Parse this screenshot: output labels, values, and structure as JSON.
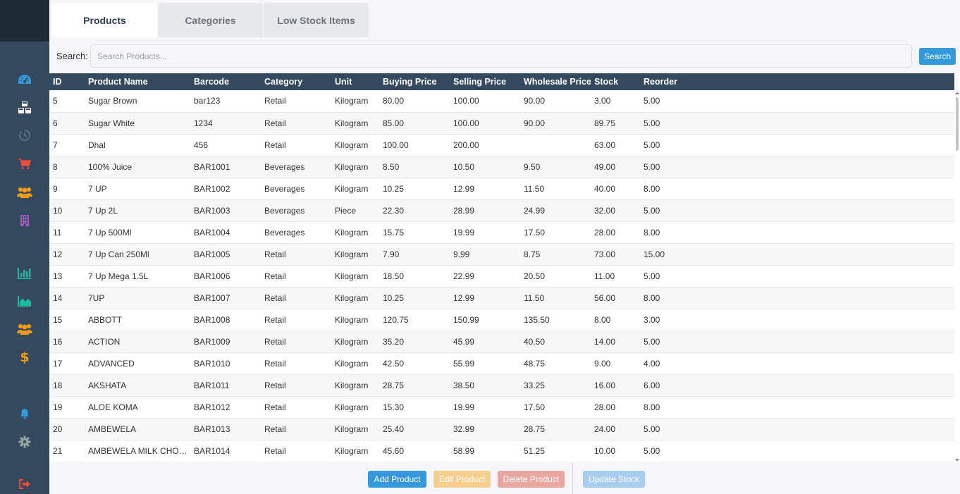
{
  "colors": {
    "sidebar_bg": "#34495e",
    "header_bg": "#34495e",
    "primary": "#3498db",
    "warning_disabled": "#f6cf8f",
    "danger_disabled": "#eaa7a1",
    "info_disabled": "#a9cdee"
  },
  "sidebar": {
    "icons": [
      {
        "name": "dashboard-icon",
        "color": "#3498db"
      },
      {
        "name": "products-cubes-icon",
        "color": "#ffffff"
      },
      {
        "name": "history-icon",
        "color": "#5d6d7e"
      },
      {
        "name": "cart-icon",
        "color": "#e74c3c"
      },
      {
        "name": "users-icon",
        "color": "#f39c12"
      },
      {
        "name": "building-icon",
        "color": "#9b59b6"
      },
      {
        "name": "bar-chart-icon",
        "color": "#1abc9c"
      },
      {
        "name": "area-chart-icon",
        "color": "#1abc9c"
      },
      {
        "name": "customers-icon",
        "color": "#f39c12"
      },
      {
        "name": "dollar-icon",
        "color": "#f39c12"
      },
      {
        "name": "bell-icon",
        "color": "#3498db"
      },
      {
        "name": "gear-icon",
        "color": "#95a5a6"
      },
      {
        "name": "logout-icon",
        "color": "#e74c3c"
      }
    ]
  },
  "tabs": [
    {
      "label": "Products"
    },
    {
      "label": "Categories"
    },
    {
      "label": "Low Stock Items"
    }
  ],
  "search": {
    "label": "Search:",
    "placeholder": "Search Products...",
    "button": "Search"
  },
  "table": {
    "columns": [
      "ID",
      "Product Name",
      "Barcode",
      "Category",
      "Unit",
      "Buying Price",
      "Selling Price",
      "Wholesale Price",
      "Stock",
      "Reorder"
    ],
    "rows": [
      [
        "5",
        "Sugar Brown",
        "bar123",
        "Retail",
        "Kilogram",
        "80.00",
        "100.00",
        "90.00",
        "3.00",
        "5.00"
      ],
      [
        "6",
        "Sugar White",
        "1234",
        "Retail",
        "Kilogram",
        "85.00",
        "100.00",
        "90.00",
        "89.75",
        "5.00"
      ],
      [
        "7",
        "Dhal",
        "456",
        "Retail",
        "Kilogram",
        "100.00",
        "200.00",
        "",
        "63.00",
        "5.00"
      ],
      [
        "8",
        "100% Juice",
        "BAR1001",
        "Beverages",
        "Kilogram",
        "8.50",
        "10.50",
        "9.50",
        "49.00",
        "5.00"
      ],
      [
        "9",
        "7 UP",
        "BAR1002",
        "Beverages",
        "Kilogram",
        "10.25",
        "12.99",
        "11.50",
        "40.00",
        "8.00"
      ],
      [
        "10",
        "7 Up 2L",
        "BAR1003",
        "Beverages",
        "Piece",
        "22.30",
        "28.99",
        "24.99",
        "32.00",
        "5.00"
      ],
      [
        "11",
        "7 Up 500Ml",
        "BAR1004",
        "Beverages",
        "Kilogram",
        "15.75",
        "19.99",
        "17.50",
        "28.00",
        "8.00"
      ],
      [
        "12",
        "7 Up Can 250Ml",
        "BAR1005",
        "Retail",
        "Kilogram",
        "7.90",
        "9.99",
        "8.75",
        "73.00",
        "15.00"
      ],
      [
        "13",
        "7 Up Mega 1.5L",
        "BAR1006",
        "Retail",
        "Kilogram",
        "18.50",
        "22.99",
        "20.50",
        "11.00",
        "5.00"
      ],
      [
        "14",
        "7UP",
        "BAR1007",
        "Retail",
        "Kilogram",
        "10.25",
        "12.99",
        "11.50",
        "56.00",
        "8.00"
      ],
      [
        "15",
        "ABBOTT",
        "BAR1008",
        "Retail",
        "Kilogram",
        "120.75",
        "150.99",
        "135.50",
        "8.00",
        "3.00"
      ],
      [
        "16",
        "ACTION",
        "BAR1009",
        "Retail",
        "Kilogram",
        "35.20",
        "45.99",
        "40.50",
        "14.00",
        "5.00"
      ],
      [
        "17",
        "ADVANCED",
        "BAR1010",
        "Retail",
        "Kilogram",
        "42.50",
        "55.99",
        "48.75",
        "9.00",
        "4.00"
      ],
      [
        "18",
        "AKSHATA",
        "BAR1011",
        "Retail",
        "Kilogram",
        "28.75",
        "38.50",
        "33.25",
        "16.00",
        "6.00"
      ],
      [
        "19",
        "ALOE KOMA",
        "BAR1012",
        "Retail",
        "Kilogram",
        "15.30",
        "19.99",
        "17.50",
        "28.00",
        "8.00"
      ],
      [
        "20",
        "AMBEWELA",
        "BAR1013",
        "Retail",
        "Kilogram",
        "25.40",
        "32.99",
        "28.75",
        "24.00",
        "5.00"
      ],
      [
        "21",
        "AMBEWELA MILK CHOC...",
        "BAR1014",
        "Retail",
        "Kilogram",
        "45.60",
        "58.99",
        "51.25",
        "10.00",
        "5.00"
      ]
    ]
  },
  "footer": {
    "add": "Add Product",
    "edit": "Edit Product",
    "delete": "Delete Product",
    "update": "Update Stock"
  }
}
